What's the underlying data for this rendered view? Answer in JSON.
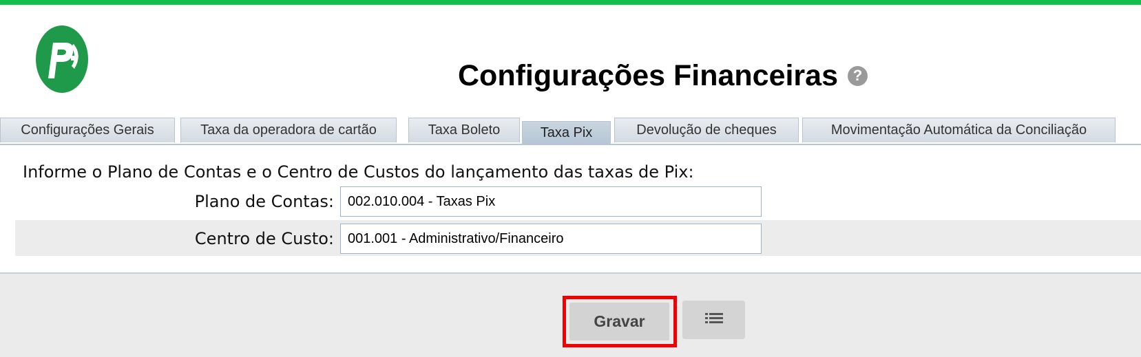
{
  "header": {
    "title": "Configurações Financeiras",
    "help_icon": "question-circle-icon",
    "logo_icon": "app-logo-icon",
    "accent_color": "#12bf4a"
  },
  "tabs": [
    {
      "label": "Configurações Gerais",
      "active": false
    },
    {
      "label": "Taxa da operadora de cartão",
      "active": false
    },
    {
      "label": "Taxa Boleto",
      "active": false
    },
    {
      "label": "Taxa Pix",
      "active": true
    },
    {
      "label": "Devolução de cheques",
      "active": false
    },
    {
      "label": "Movimentação Automática da Conciliação",
      "active": false
    }
  ],
  "form": {
    "heading": "Informe o Plano de Contas e o Centro de Custos do lançamento das taxas de Pix:",
    "plano_label": "Plano de Contas:",
    "plano_value": "002.010.004 - Taxas Pix",
    "centro_label": "Centro de Custo:",
    "centro_value": "001.001 - Administrativo/Financeiro"
  },
  "footer": {
    "save_label": "Gravar",
    "list_icon": "list-icon",
    "highlight_color": "#f00000"
  }
}
